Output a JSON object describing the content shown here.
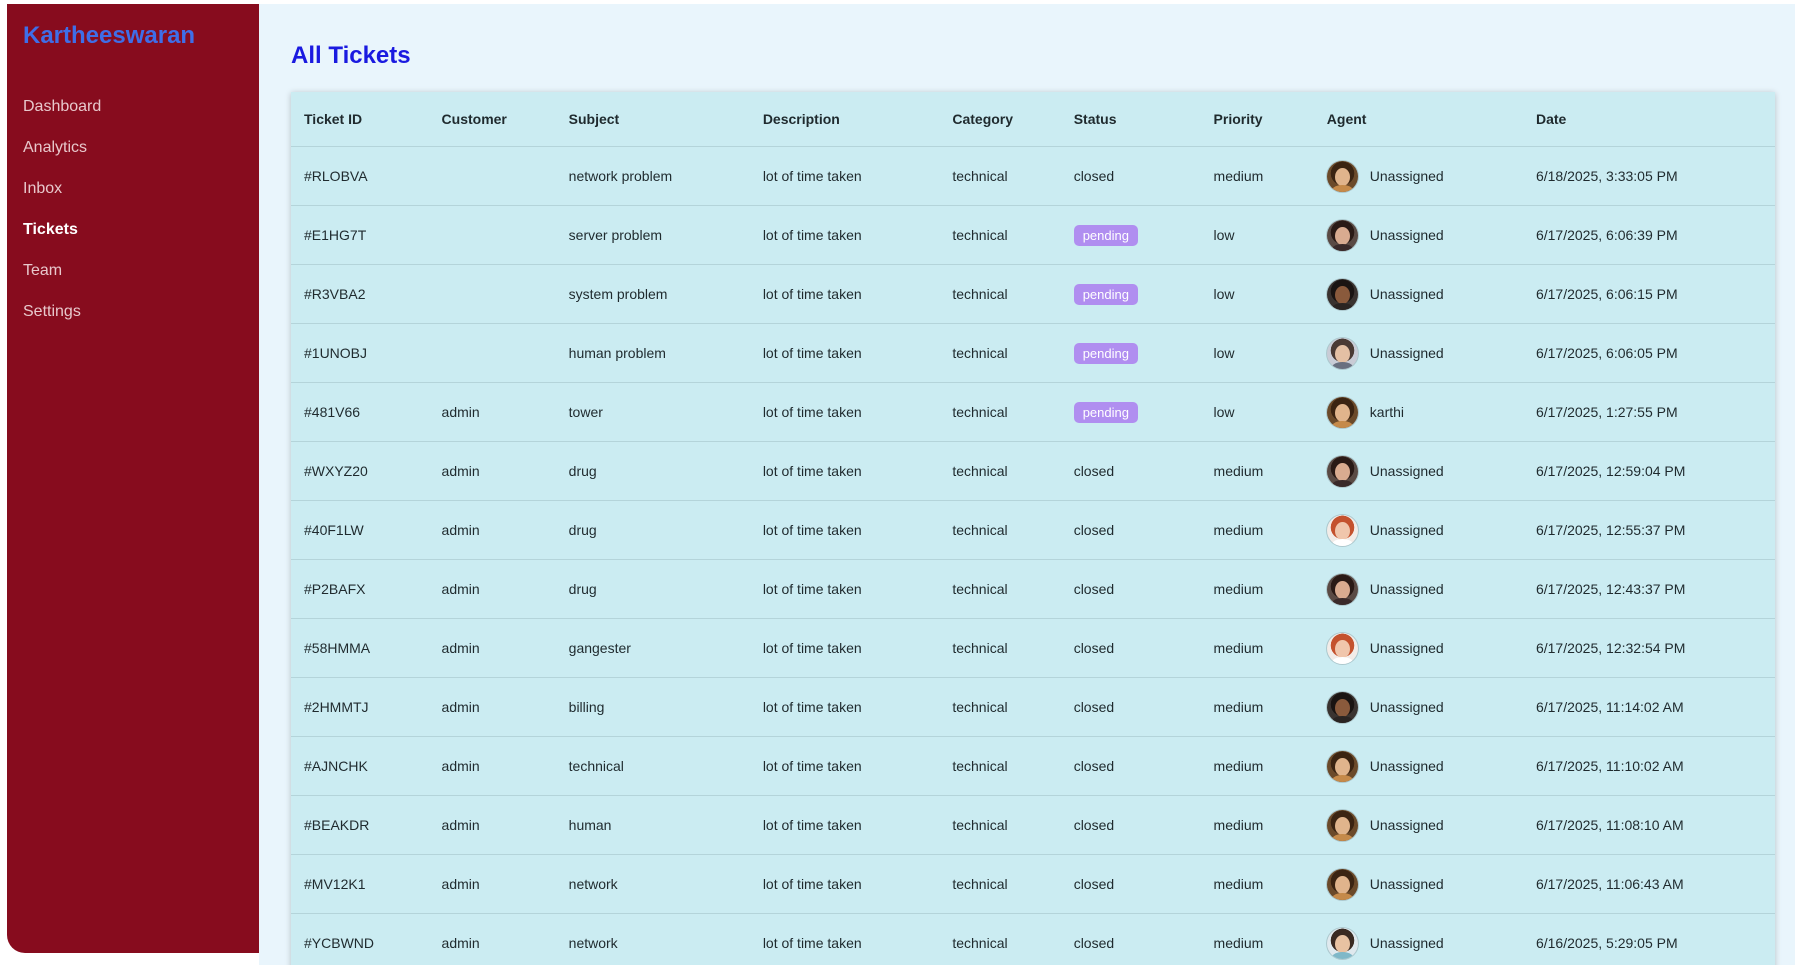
{
  "app": {
    "brand": "Kartheeswaran"
  },
  "sidebar": {
    "items": [
      {
        "label": "Dashboard",
        "active": false
      },
      {
        "label": "Analytics",
        "active": false
      },
      {
        "label": "Inbox",
        "active": false
      },
      {
        "label": "Tickets",
        "active": true
      },
      {
        "label": "Team",
        "active": false
      },
      {
        "label": "Settings",
        "active": false
      }
    ]
  },
  "page": {
    "title": "All Tickets"
  },
  "table": {
    "columns": [
      "Ticket ID",
      "Customer",
      "Subject",
      "Description",
      "Category",
      "Status",
      "Priority",
      "Agent",
      "Date"
    ],
    "rows": [
      {
        "id": "#RLOBVA",
        "customer": "",
        "subject": "network problem",
        "description": "lot of time taken",
        "category": "technical",
        "status": "closed",
        "priority": "medium",
        "agent": "Unassigned",
        "date": "6/18/2025, 3:33:05 PM",
        "avatar": "woman-curly"
      },
      {
        "id": "#E1HG7T",
        "customer": "",
        "subject": "server problem",
        "description": "lot of time taken",
        "category": "technical",
        "status": "pending",
        "priority": "low",
        "agent": "Unassigned",
        "date": "6/17/2025, 6:06:39 PM",
        "avatar": "woman-dark"
      },
      {
        "id": "#R3VBA2",
        "customer": "",
        "subject": "system problem",
        "description": "lot of time taken",
        "category": "technical",
        "status": "pending",
        "priority": "low",
        "agent": "Unassigned",
        "date": "6/17/2025, 6:06:15 PM",
        "avatar": "man-dark"
      },
      {
        "id": "#1UNOBJ",
        "customer": "",
        "subject": "human problem",
        "description": "lot of time taken",
        "category": "technical",
        "status": "pending",
        "priority": "low",
        "agent": "Unassigned",
        "date": "6/17/2025, 6:06:05 PM",
        "avatar": "man-glasses"
      },
      {
        "id": "#481V66",
        "customer": "admin",
        "subject": "tower",
        "description": "lot of time taken",
        "category": "technical",
        "status": "pending",
        "priority": "low",
        "agent": "karthi",
        "date": "6/17/2025, 1:27:55 PM",
        "avatar": "woman-curly"
      },
      {
        "id": "#WXYZ20",
        "customer": "admin",
        "subject": "drug",
        "description": "lot of time taken",
        "category": "technical",
        "status": "closed",
        "priority": "medium",
        "agent": "Unassigned",
        "date": "6/17/2025, 12:59:04 PM",
        "avatar": "woman-dark"
      },
      {
        "id": "#40F1LW",
        "customer": "admin",
        "subject": "drug",
        "description": "lot of time taken",
        "category": "technical",
        "status": "closed",
        "priority": "medium",
        "agent": "Unassigned",
        "date": "6/17/2025, 12:55:37 PM",
        "avatar": "man-red"
      },
      {
        "id": "#P2BAFX",
        "customer": "admin",
        "subject": "drug",
        "description": "lot of time taken",
        "category": "technical",
        "status": "closed",
        "priority": "medium",
        "agent": "Unassigned",
        "date": "6/17/2025, 12:43:37 PM",
        "avatar": "woman-dark"
      },
      {
        "id": "#58HMMA",
        "customer": "admin",
        "subject": "gangester",
        "description": "lot of time taken",
        "category": "technical",
        "status": "closed",
        "priority": "medium",
        "agent": "Unassigned",
        "date": "6/17/2025, 12:32:54 PM",
        "avatar": "man-red"
      },
      {
        "id": "#2HMMTJ",
        "customer": "admin",
        "subject": "billing",
        "description": "lot of time taken",
        "category": "technical",
        "status": "closed",
        "priority": "medium",
        "agent": "Unassigned",
        "date": "6/17/2025, 11:14:02 AM",
        "avatar": "man-dark"
      },
      {
        "id": "#AJNCHK",
        "customer": "admin",
        "subject": "technical",
        "description": "lot of time taken",
        "category": "technical",
        "status": "closed",
        "priority": "medium",
        "agent": "Unassigned",
        "date": "6/17/2025, 11:10:02 AM",
        "avatar": "woman-curly"
      },
      {
        "id": "#BEAKDR",
        "customer": "admin",
        "subject": "human",
        "description": "lot of time taken",
        "category": "technical",
        "status": "closed",
        "priority": "medium",
        "agent": "Unassigned",
        "date": "6/17/2025, 11:08:10 AM",
        "avatar": "woman-curly"
      },
      {
        "id": "#MV12K1",
        "customer": "admin",
        "subject": "network",
        "description": "lot of time taken",
        "category": "technical",
        "status": "closed",
        "priority": "medium",
        "agent": "Unassigned",
        "date": "6/17/2025, 11:06:43 AM",
        "avatar": "woman-curly"
      },
      {
        "id": "#YCBWND",
        "customer": "admin",
        "subject": "network",
        "description": "lot of time taken",
        "category": "technical",
        "status": "closed",
        "priority": "medium",
        "agent": "Unassigned",
        "date": "6/16/2025, 5:29:05 PM",
        "avatar": "man-light"
      }
    ]
  },
  "colors": {
    "sidebar": "#870c1e",
    "brand": "#3f6ee8",
    "title": "#1a1ae0",
    "table_bg": "#cbecf2",
    "pending_badge": "#b08ef0"
  }
}
